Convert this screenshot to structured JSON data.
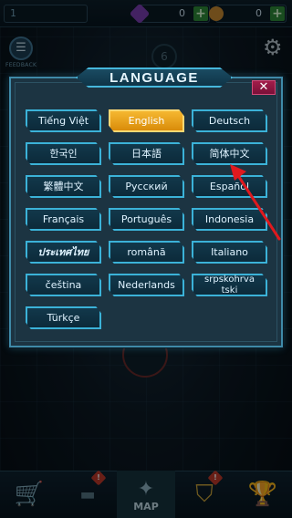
{
  "topbar": {
    "level": "1",
    "purple_amount": "0",
    "coin_amount": "0"
  },
  "feedback": {
    "label": "FEEDBACK"
  },
  "map_nodes": {
    "node_top": "6"
  },
  "bottom_nav": {
    "map_label": "MAP"
  },
  "modal": {
    "title": "LANGUAGE",
    "close_label": "✕",
    "selected": "English",
    "languages": [
      "Tiếng Việt",
      "English",
      "Deutsch",
      "한국인",
      "日本語",
      "简体中文",
      "繁體中文",
      "Русский",
      "Español",
      "Français",
      "Português",
      "Indonesia",
      "ประเทศไทย",
      "română",
      "Italiano",
      "čeština",
      "Nederlands",
      "srpskohrvatski",
      "Türkçe"
    ]
  },
  "colors": {
    "accent": "#3bb2d8",
    "selected": "#f0a81e",
    "close": "#a21d4a",
    "annotation_arrow": "#e0191e"
  }
}
